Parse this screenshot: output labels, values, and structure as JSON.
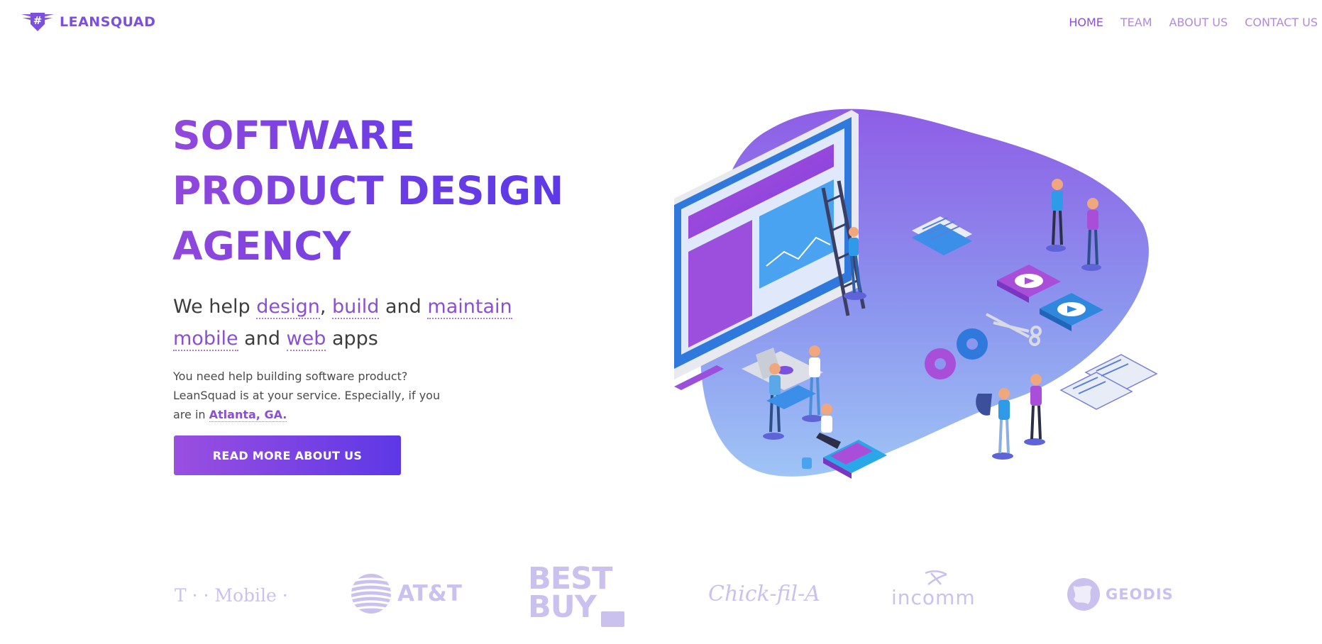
{
  "brand": {
    "name": "LEANSQUAD",
    "color": "#7b4fe0"
  },
  "nav": [
    {
      "label": "HOME",
      "active": true
    },
    {
      "label": "TEAM",
      "active": false
    },
    {
      "label": "ABOUT US",
      "active": false
    },
    {
      "label": "CONTACT US",
      "active": false
    }
  ],
  "hero": {
    "headline": [
      "SOFTWARE",
      "PRODUCT DESIGN",
      "AGENCY"
    ],
    "sub": {
      "we_help": "We help ",
      "design": "design",
      "comma": ", ",
      "build": "build",
      "and1": " and ",
      "maintain": "maintain",
      "mobile": "mobile",
      "and2": " and ",
      "web": "web",
      "apps": " apps"
    },
    "description": "You need help building software product? LeanSquad is at your service. Especially, if you are in",
    "location": "Atlanta, GA.",
    "cta": "READ MORE ABOUT US"
  },
  "clients": [
    "T · · Mobile ·",
    "AT&T",
    "BEST BUY",
    "Chick-fil-A",
    "incomm",
    "GEODIS"
  ],
  "colors": {
    "accent": "#7b40e0",
    "accent_end": "#5d38e6",
    "logo_gray": "#cbc1ef"
  }
}
